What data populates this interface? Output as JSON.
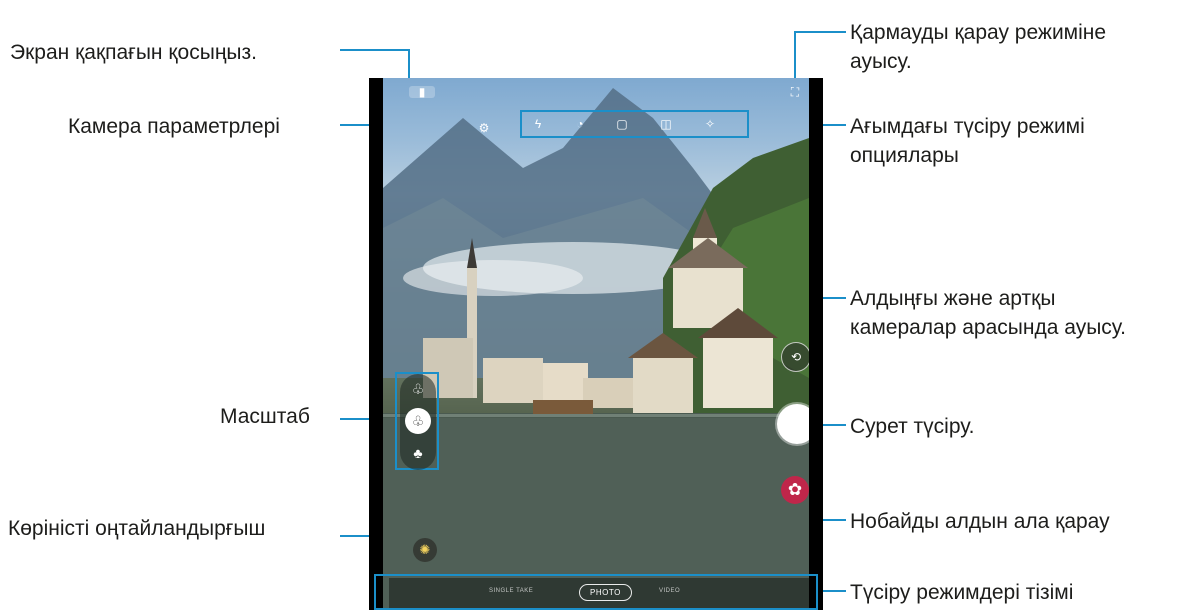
{
  "callouts": {
    "screen_lock": "Экран қақпағын қосыңыз.",
    "settings": "Камера параметрлері",
    "zoom": "Масштаб",
    "scene_optimizer": "Көріністі оңтайландырғыш",
    "view_mode_line1": "Қармауды қарау режиміне",
    "view_mode_line2": "ауысу.",
    "options_line1": "Ағымдағы түсіру режимі",
    "options_line2": "опциялары",
    "switch_line1": "Алдыңғы және артқы",
    "switch_line2": "камералар арасында ауысу.",
    "capture": "Сурет түсіру.",
    "preview": "Нобайды алдын ала қарау",
    "modes_list": "Түсіру режимдері тізімі"
  },
  "camera": {
    "current_mode": "PHOTO",
    "mode_left": "SINGLE TAKE",
    "mode_right": "VIDEO",
    "option_icons": [
      "flash-off-icon",
      "timer-icon",
      "aspect-ratio-icon",
      "motion-photo-icon",
      "filter-icon"
    ],
    "zoom_icons": [
      "telephoto-icon",
      "wide-icon",
      "ultra-wide-icon"
    ]
  },
  "colors": {
    "accent": "#1b8fc9",
    "thumbnail": "#c0264a"
  }
}
